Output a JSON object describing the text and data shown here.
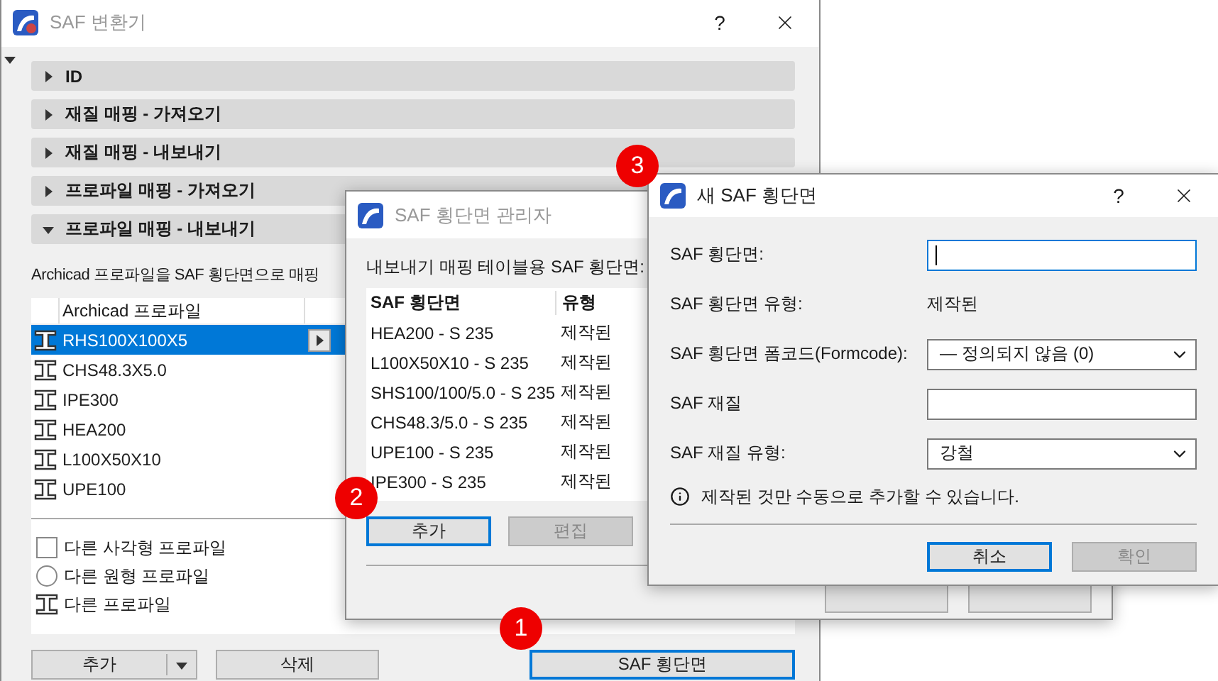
{
  "main_window": {
    "title": "SAF 변환기",
    "help": "?",
    "sections": [
      {
        "label": "ID",
        "expanded": false
      },
      {
        "label": "재질 매핑 - 가져오기",
        "expanded": false
      },
      {
        "label": "재질 매핑 - 내보내기",
        "expanded": false
      },
      {
        "label": "프로파일 매핑 - 가져오기",
        "expanded": false
      },
      {
        "label": "프로파일 매핑 - 내보내기",
        "expanded": true
      }
    ],
    "description": "Archicad 프로파일을 SAF 횡단면으로 매핑",
    "table": {
      "column": "Archicad 프로파일",
      "rows": [
        {
          "name": "RHS100X100X5",
          "selected": true
        },
        {
          "name": "CHS48.3X5.0",
          "selected": false
        },
        {
          "name": "IPE300",
          "selected": false
        },
        {
          "name": "HEA200",
          "selected": false
        },
        {
          "name": "L100X50X10",
          "selected": false
        },
        {
          "name": "UPE100",
          "selected": false
        }
      ],
      "others": [
        {
          "kind": "rect",
          "label": "다른 사각형 프로파일"
        },
        {
          "kind": "circle",
          "label": "다른 원형 프로파일"
        },
        {
          "kind": "profile",
          "label": "다른 프로파일"
        }
      ]
    },
    "buttons": [
      {
        "kind": "split",
        "label": "추가",
        "focused": false
      },
      {
        "kind": "plain",
        "label": "삭제",
        "focused": false
      },
      {
        "kind": "plain",
        "label": "SAF 횡단면",
        "focused": true
      }
    ]
  },
  "manager_window": {
    "title": "SAF 횡단면 관리자",
    "caption": "내보내기 매핑 테이블용 SAF 횡단면:",
    "columns": [
      "SAF 횡단면",
      "유형"
    ],
    "rows": [
      {
        "name": "HEA200 - S 235",
        "type": "제작된"
      },
      {
        "name": "L100X50X10 - S 235",
        "type": "제작된"
      },
      {
        "name": "SHS100/100/5.0 - S 235",
        "type": "제작된"
      },
      {
        "name": "CHS48.3/5.0 - S 235",
        "type": "제작된"
      },
      {
        "name": "UPE100 - S 235",
        "type": "제작된"
      },
      {
        "name": "IPE300 - S 235",
        "type": "제작된"
      }
    ],
    "buttons": [
      {
        "label": "추가",
        "focused": true,
        "disabled": false
      },
      {
        "label": "편집",
        "focused": false,
        "disabled": true
      }
    ]
  },
  "new_dialog": {
    "title": "새 SAF 횡단면",
    "help": "?",
    "fields": [
      {
        "kind": "text",
        "label": "SAF 횡단면:",
        "focused": true
      },
      {
        "kind": "static",
        "label": "SAF 횡단면 유형:",
        "value": "제작된"
      },
      {
        "kind": "select",
        "label": "SAF 횡단면 폼코드(Formcode):",
        "value": "— 정의되지 않음 (0)"
      },
      {
        "kind": "text",
        "label": "SAF 재질",
        "focused": false
      },
      {
        "kind": "select",
        "label": "SAF 재질 유형:",
        "value": "강철"
      }
    ],
    "info": "제작된 것만 수동으로 추가할 수 있습니다.",
    "buttons": [
      {
        "label": "취소",
        "focused": true,
        "disabled": false
      },
      {
        "label": "확인",
        "focused": false,
        "disabled": true
      }
    ]
  },
  "callouts": [
    {
      "number": "1"
    },
    {
      "number": "2"
    },
    {
      "number": "3"
    }
  ]
}
